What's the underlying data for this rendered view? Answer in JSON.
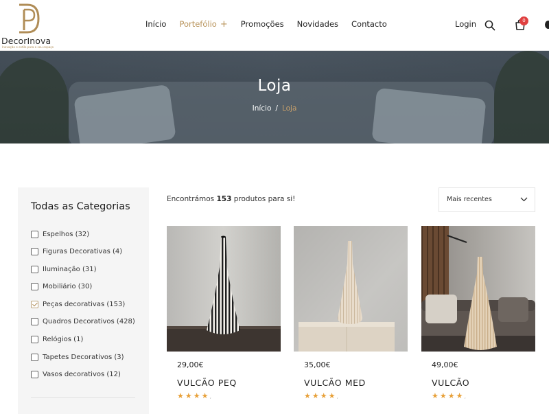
{
  "logo": {
    "name": "DecorInova",
    "tagline": "Inovação e estilo para o seu espaço",
    "brand_color": "#b08d57"
  },
  "nav": {
    "items": [
      {
        "label": "Início"
      },
      {
        "label": "Portefólio",
        "active": true,
        "expandable": true
      },
      {
        "label": "Promoções"
      },
      {
        "label": "Novidades"
      },
      {
        "label": "Contacto"
      }
    ],
    "login": "Login",
    "cart_count": "0"
  },
  "banner": {
    "title": "Loja",
    "breadcrumb": {
      "home": "Início",
      "separator": "/",
      "current": "Loja"
    }
  },
  "sidebar": {
    "title": "Todas as Categorias",
    "categories": [
      {
        "label": "Espelhos (32)",
        "checked": false
      },
      {
        "label": "Figuras Decorativas (4)",
        "checked": false
      },
      {
        "label": "Iluminação (31)",
        "checked": false
      },
      {
        "label": "Mobiliário (30)",
        "checked": false
      },
      {
        "label": "Peças decorativas (153)",
        "checked": true
      },
      {
        "label": "Quadros Decorativos (428)",
        "checked": false
      },
      {
        "label": "Relógios (1)",
        "checked": false
      },
      {
        "label": "Tapetes Decorativos (3)",
        "checked": false
      },
      {
        "label": "Vasos decorativos (12)",
        "checked": false
      }
    ]
  },
  "results": {
    "prefix": "Encontrámos",
    "count": "153",
    "suffix": "produtos para si!"
  },
  "sort": {
    "selected": "Mais recentes"
  },
  "products": [
    {
      "price": "29,00€",
      "name": "VULCÃO PEQ",
      "stars": "★★★★",
      "rating": 4
    },
    {
      "price": "35,00€",
      "name": "VULCÃO MED",
      "stars": "★★★★",
      "rating": 4
    },
    {
      "price": "49,00€",
      "name": "VULCÃO",
      "stars": "★★★★",
      "rating": 4
    }
  ],
  "colors": {
    "accent": "#b8935a",
    "star": "#e8a13a",
    "badge": "#e04040"
  }
}
